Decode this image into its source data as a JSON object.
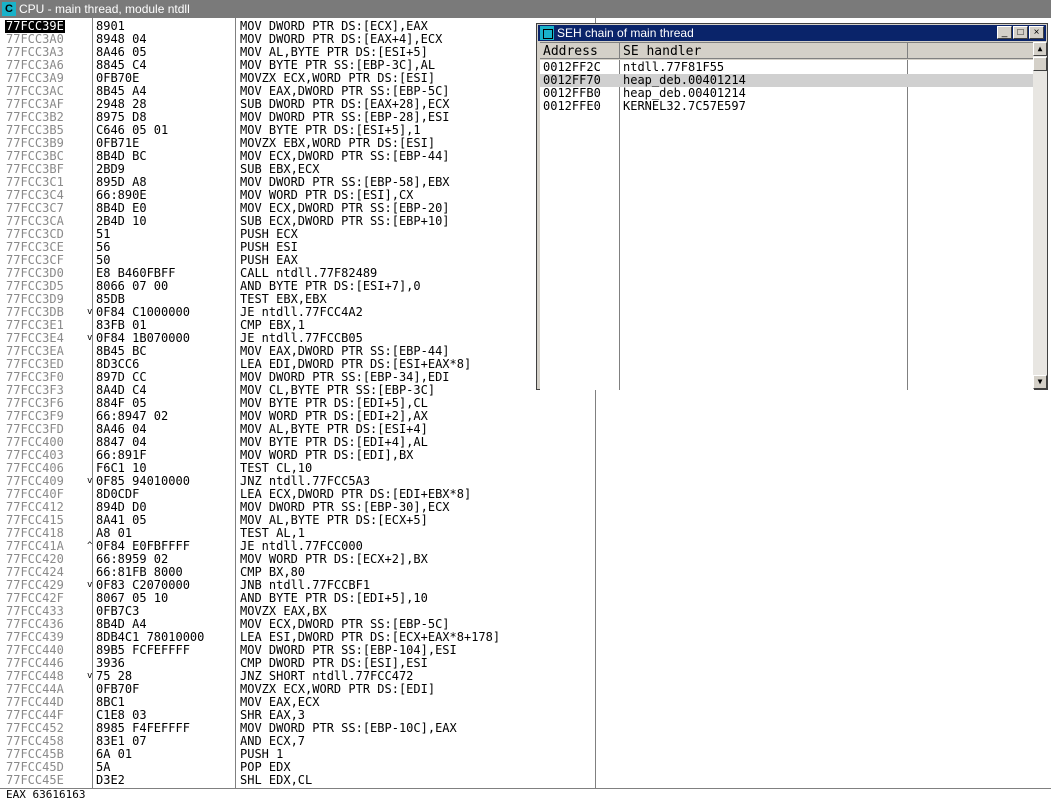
{
  "window": {
    "icon_letter": "C",
    "title": "CPU - main thread, module ntdll"
  },
  "cpu": {
    "selected_address": "77FCC39E",
    "rows": [
      {
        "addr": "77FCC39E",
        "arrow": "",
        "hex": "8901",
        "dis": "MOV DWORD PTR DS:[ECX],EAX"
      },
      {
        "addr": "77FCC3A0",
        "arrow": "",
        "hex": "8948 04",
        "dis": "MOV DWORD PTR DS:[EAX+4],ECX"
      },
      {
        "addr": "77FCC3A3",
        "arrow": "",
        "hex": "8A46 05",
        "dis": "MOV AL,BYTE PTR DS:[ESI+5]"
      },
      {
        "addr": "77FCC3A6",
        "arrow": "",
        "hex": "8845 C4",
        "dis": "MOV BYTE PTR SS:[EBP-3C],AL"
      },
      {
        "addr": "77FCC3A9",
        "arrow": "",
        "hex": "0FB70E",
        "dis": "MOVZX ECX,WORD PTR DS:[ESI]"
      },
      {
        "addr": "77FCC3AC",
        "arrow": "",
        "hex": "8B45 A4",
        "dis": "MOV EAX,DWORD PTR SS:[EBP-5C]"
      },
      {
        "addr": "77FCC3AF",
        "arrow": "",
        "hex": "2948 28",
        "dis": "SUB DWORD PTR DS:[EAX+28],ECX"
      },
      {
        "addr": "77FCC3B2",
        "arrow": "",
        "hex": "8975 D8",
        "dis": "MOV DWORD PTR SS:[EBP-28],ESI"
      },
      {
        "addr": "77FCC3B5",
        "arrow": "",
        "hex": "C646 05 01",
        "dis": "MOV BYTE PTR DS:[ESI+5],1"
      },
      {
        "addr": "77FCC3B9",
        "arrow": "",
        "hex": "0FB71E",
        "dis": "MOVZX EBX,WORD PTR DS:[ESI]"
      },
      {
        "addr": "77FCC3BC",
        "arrow": "",
        "hex": "8B4D BC",
        "dis": "MOV ECX,DWORD PTR SS:[EBP-44]"
      },
      {
        "addr": "77FCC3BF",
        "arrow": "",
        "hex": "2BD9",
        "dis": "SUB EBX,ECX"
      },
      {
        "addr": "77FCC3C1",
        "arrow": "",
        "hex": "895D A8",
        "dis": "MOV DWORD PTR SS:[EBP-58],EBX"
      },
      {
        "addr": "77FCC3C4",
        "arrow": "",
        "hex": "66:890E",
        "dis": "MOV WORD PTR DS:[ESI],CX"
      },
      {
        "addr": "77FCC3C7",
        "arrow": "",
        "hex": "8B4D E0",
        "dis": "MOV ECX,DWORD PTR SS:[EBP-20]"
      },
      {
        "addr": "77FCC3CA",
        "arrow": "",
        "hex": "2B4D 10",
        "dis": "SUB ECX,DWORD PTR SS:[EBP+10]"
      },
      {
        "addr": "77FCC3CD",
        "arrow": "",
        "hex": "51",
        "dis": "PUSH ECX"
      },
      {
        "addr": "77FCC3CE",
        "arrow": "",
        "hex": "56",
        "dis": "PUSH ESI"
      },
      {
        "addr": "77FCC3CF",
        "arrow": "",
        "hex": "50",
        "dis": "PUSH EAX"
      },
      {
        "addr": "77FCC3D0",
        "arrow": "",
        "hex": "E8 B460FBFF",
        "dis": "CALL ntdll.77F82489"
      },
      {
        "addr": "77FCC3D5",
        "arrow": "",
        "hex": "8066 07 00",
        "dis": "AND BYTE PTR DS:[ESI+7],0"
      },
      {
        "addr": "77FCC3D9",
        "arrow": "",
        "hex": "85DB",
        "dis": "TEST EBX,EBX"
      },
      {
        "addr": "77FCC3DB",
        "arrow": "v",
        "hex": "0F84 C1000000",
        "dis": "JE ntdll.77FCC4A2"
      },
      {
        "addr": "77FCC3E1",
        "arrow": "",
        "hex": "83FB 01",
        "dis": "CMP EBX,1"
      },
      {
        "addr": "77FCC3E4",
        "arrow": "v",
        "hex": "0F84 1B070000",
        "dis": "JE ntdll.77FCCB05"
      },
      {
        "addr": "77FCC3EA",
        "arrow": "",
        "hex": "8B45 BC",
        "dis": "MOV EAX,DWORD PTR SS:[EBP-44]"
      },
      {
        "addr": "77FCC3ED",
        "arrow": "",
        "hex": "8D3CC6",
        "dis": "LEA EDI,DWORD PTR DS:[ESI+EAX*8]"
      },
      {
        "addr": "77FCC3F0",
        "arrow": "",
        "hex": "897D CC",
        "dis": "MOV DWORD PTR SS:[EBP-34],EDI"
      },
      {
        "addr": "77FCC3F3",
        "arrow": "",
        "hex": "8A4D C4",
        "dis": "MOV CL,BYTE PTR SS:[EBP-3C]"
      },
      {
        "addr": "77FCC3F6",
        "arrow": "",
        "hex": "884F 05",
        "dis": "MOV BYTE PTR DS:[EDI+5],CL"
      },
      {
        "addr": "77FCC3F9",
        "arrow": "",
        "hex": "66:8947 02",
        "dis": "MOV WORD PTR DS:[EDI+2],AX"
      },
      {
        "addr": "77FCC3FD",
        "arrow": "",
        "hex": "8A46 04",
        "dis": "MOV AL,BYTE PTR DS:[ESI+4]"
      },
      {
        "addr": "77FCC400",
        "arrow": "",
        "hex": "8847 04",
        "dis": "MOV BYTE PTR DS:[EDI+4],AL"
      },
      {
        "addr": "77FCC403",
        "arrow": "",
        "hex": "66:891F",
        "dis": "MOV WORD PTR DS:[EDI],BX"
      },
      {
        "addr": "77FCC406",
        "arrow": "",
        "hex": "F6C1 10",
        "dis": "TEST CL,10"
      },
      {
        "addr": "77FCC409",
        "arrow": "v",
        "hex": "0F85 94010000",
        "dis": "JNZ ntdll.77FCC5A3"
      },
      {
        "addr": "77FCC40F",
        "arrow": "",
        "hex": "8D0CDF",
        "dis": "LEA ECX,DWORD PTR DS:[EDI+EBX*8]"
      },
      {
        "addr": "77FCC412",
        "arrow": "",
        "hex": "894D D0",
        "dis": "MOV DWORD PTR SS:[EBP-30],ECX"
      },
      {
        "addr": "77FCC415",
        "arrow": "",
        "hex": "8A41 05",
        "dis": "MOV AL,BYTE PTR DS:[ECX+5]"
      },
      {
        "addr": "77FCC418",
        "arrow": "",
        "hex": "A8 01",
        "dis": "TEST AL,1"
      },
      {
        "addr": "77FCC41A",
        "arrow": "^",
        "hex": "0F84 E0FBFFFF",
        "dis": "JE ntdll.77FCC000"
      },
      {
        "addr": "77FCC420",
        "arrow": "",
        "hex": "66:8959 02",
        "dis": "MOV WORD PTR DS:[ECX+2],BX"
      },
      {
        "addr": "77FCC424",
        "arrow": "",
        "hex": "66:81FB 8000",
        "dis": "CMP BX,80"
      },
      {
        "addr": "77FCC429",
        "arrow": "v",
        "hex": "0F83 C2070000",
        "dis": "JNB ntdll.77FCCBF1"
      },
      {
        "addr": "77FCC42F",
        "arrow": "",
        "hex": "8067 05 10",
        "dis": "AND BYTE PTR DS:[EDI+5],10"
      },
      {
        "addr": "77FCC433",
        "arrow": "",
        "hex": "0FB7C3",
        "dis": "MOVZX EAX,BX"
      },
      {
        "addr": "77FCC436",
        "arrow": "",
        "hex": "8B4D A4",
        "dis": "MOV ECX,DWORD PTR SS:[EBP-5C]"
      },
      {
        "addr": "77FCC439",
        "arrow": "",
        "hex": "8DB4C1 78010000",
        "dis": "LEA ESI,DWORD PTR DS:[ECX+EAX*8+178]"
      },
      {
        "addr": "77FCC440",
        "arrow": "",
        "hex": "89B5 FCFEFFFF",
        "dis": "MOV DWORD PTR SS:[EBP-104],ESI"
      },
      {
        "addr": "77FCC446",
        "arrow": "",
        "hex": "3936",
        "dis": "CMP DWORD PTR DS:[ESI],ESI"
      },
      {
        "addr": "77FCC448",
        "arrow": "v",
        "hex": "75 28",
        "dis": "JNZ SHORT ntdll.77FCC472"
      },
      {
        "addr": "77FCC44A",
        "arrow": "",
        "hex": "0FB70F",
        "dis": "MOVZX ECX,WORD PTR DS:[EDI]"
      },
      {
        "addr": "77FCC44D",
        "arrow": "",
        "hex": "8BC1",
        "dis": "MOV EAX,ECX"
      },
      {
        "addr": "77FCC44F",
        "arrow": "",
        "hex": "C1E8 03",
        "dis": "SHR EAX,3"
      },
      {
        "addr": "77FCC452",
        "arrow": "",
        "hex": "8985 F4FEFFFF",
        "dis": "MOV DWORD PTR SS:[EBP-10C],EAX"
      },
      {
        "addr": "77FCC458",
        "arrow": "",
        "hex": "83E1 07",
        "dis": "AND ECX,7"
      },
      {
        "addr": "77FCC45B",
        "arrow": "",
        "hex": "6A 01",
        "dis": "PUSH 1"
      },
      {
        "addr": "77FCC45D",
        "arrow": "",
        "hex": "5A",
        "dis": "POP EDX"
      },
      {
        "addr": "77FCC45E",
        "arrow": "",
        "hex": "D3E2",
        "dis": "SHL EDX,CL"
      }
    ],
    "status_line": "EAX 63616163"
  },
  "seh": {
    "title": "SEH chain of main thread",
    "columns": [
      "Address",
      "SE handler"
    ],
    "rows": [
      {
        "address": "0012FF2C",
        "handler": "ntdll.77F81F55"
      },
      {
        "address": "0012FF70",
        "handler": "heap_deb.00401214"
      },
      {
        "address": "0012FFB0",
        "handler": "heap_deb.00401214"
      },
      {
        "address": "0012FFE0",
        "handler": "KERNEL32.7C57E597"
      }
    ],
    "selected_index": 1,
    "buttons": {
      "minimize": "_",
      "maximize": "□",
      "close": "×"
    },
    "scroll": {
      "up": "▲",
      "down": "▼"
    }
  }
}
